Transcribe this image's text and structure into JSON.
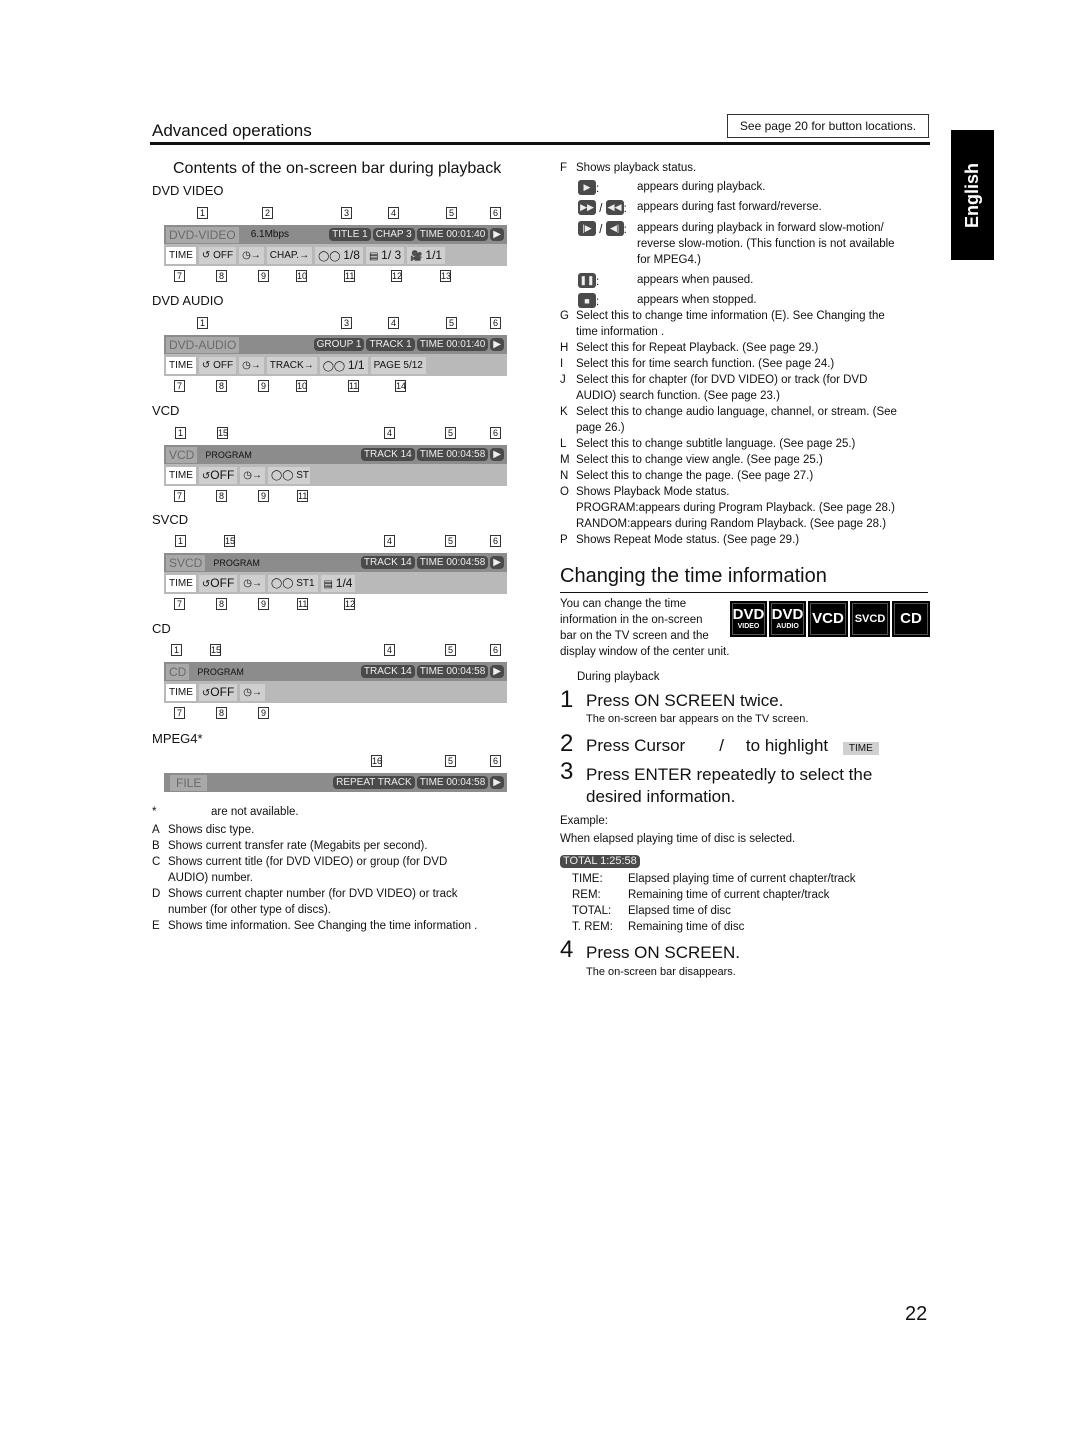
{
  "header": {
    "section_title": "Advanced operations",
    "button_note": "See page 20 for button locations.",
    "language_tab": "English"
  },
  "left": {
    "subtitle": "Contents of the on-screen bar during playback",
    "discs": [
      {
        "label": "DVD VIDEO",
        "type": "DVD-VIDEO",
        "rate": "6.1Mbps",
        "pills": [
          "TITLE  1",
          "CHAP  3",
          "TIME 00:01:40"
        ],
        "bottom": [
          "TIME",
          "OFF",
          "→",
          "CHAP.→",
          "1/8",
          "1/ 3",
          "1/1"
        ],
        "top_nums": [
          "1",
          "2",
          "3",
          "4",
          "5",
          "6"
        ],
        "bottom_nums": [
          "7",
          "8",
          "9",
          "10",
          "11",
          "12",
          "13"
        ]
      },
      {
        "label": "DVD AUDIO",
        "type": "DVD-AUDIO",
        "pills": [
          "GROUP 1",
          "TRACK 1",
          "TIME 00:01:40"
        ],
        "bottom": [
          "TIME",
          "OFF",
          "→",
          "TRACK→",
          "1/1",
          "PAGE 5/12"
        ],
        "top_nums": [
          "1",
          "3",
          "4",
          "5",
          "6"
        ],
        "bottom_nums": [
          "7",
          "8",
          "9",
          "10",
          "11",
          "14"
        ]
      },
      {
        "label": "VCD",
        "type": "VCD",
        "mode": "PROGRAM",
        "pills": [
          "TRACK 14",
          "TIME 00:04:58"
        ],
        "bottom": [
          "TIME",
          "OFF",
          "→",
          "ST"
        ],
        "top_nums": [
          "1",
          "15",
          "4",
          "5",
          "6"
        ],
        "bottom_nums": [
          "7",
          "8",
          "9",
          "11"
        ]
      },
      {
        "label": "SVCD",
        "type": "SVCD",
        "mode": "PROGRAM",
        "pills": [
          "TRACK 14",
          "TIME 00:04:58"
        ],
        "bottom": [
          "TIME",
          "OFF",
          "→",
          "ST1",
          "1/4"
        ],
        "top_nums": [
          "1",
          "15",
          "4",
          "5",
          "6"
        ],
        "bottom_nums": [
          "7",
          "8",
          "9",
          "11",
          "12"
        ]
      },
      {
        "label": "CD",
        "type": "CD",
        "mode": "PROGRAM",
        "pills": [
          "TRACK 14",
          "TIME 00:04:58"
        ],
        "bottom": [
          "TIME",
          "OFF",
          "→"
        ],
        "top_nums": [
          "1",
          "15",
          "4",
          "5",
          "6"
        ],
        "bottom_nums": [
          "7",
          "8",
          "9"
        ]
      },
      {
        "label": "MPEG4*",
        "type": "FILE",
        "pills": [
          "REPEAT TRACK",
          "TIME 00:04:58"
        ],
        "top_nums": [
          "16",
          "5",
          "6"
        ]
      }
    ],
    "footnote_mark": "*",
    "footnote": "are not available.",
    "items": [
      {
        "k": "A",
        "t": "Shows disc type."
      },
      {
        "k": "B",
        "t": "Shows current transfer rate (Megabits per second)."
      },
      {
        "k": "C",
        "t": "Shows current title (for DVD VIDEO) or group (for DVD",
        "t2": "AUDIO) number."
      },
      {
        "k": "D",
        "t": "Shows current chapter number (for DVD VIDEO) or track",
        "t2": "number (for other type of discs)."
      },
      {
        "k": "E",
        "t": "Shows time information. See   Changing the time information  ."
      }
    ]
  },
  "right": {
    "F": {
      "k": "F",
      "t": "Shows playback status."
    },
    "status": [
      {
        "sym": "▶",
        "t": "appears during playback."
      },
      {
        "sym": "▶▶",
        "sym2": "◀◀",
        "t": "appears during fast forward/reverse."
      },
      {
        "sym": "|▶",
        "sym2": "◀|",
        "t": "appears during playback in forward slow-motion/",
        "t2": "reverse slow-motion. (This function is not available",
        "t3": "for MPEG4.)"
      },
      {
        "sym": "❚❚",
        "t": "appears when paused."
      },
      {
        "sym": "■",
        "t": "appears when stopped."
      }
    ],
    "items": [
      {
        "k": "G",
        "t": "Select this to change time information (E). See   Changing the",
        "t2": "time information  ."
      },
      {
        "k": "H",
        "t": "Select this for Repeat Playback. (See page 29.)"
      },
      {
        "k": "I",
        "t": "Select this for time search function. (See page 24.)"
      },
      {
        "k": "J",
        "t": "Select this for chapter (for DVD VIDEO) or track (for DVD",
        "t2": "AUDIO) search function. (See page 23.)"
      },
      {
        "k": "K",
        "t": "Select this to change audio language, channel, or stream. (See",
        "t2": "page 26.)"
      },
      {
        "k": "L",
        "t": "Select this to change subtitle language. (See page 25.)"
      },
      {
        "k": "M",
        "t": "Select this to change view angle. (See page 25.)"
      },
      {
        "k": "N",
        "t": "Select this to change the page. (See page 27.)"
      },
      {
        "k": "O",
        "t": "Shows Playback Mode status.",
        "t2": "PROGRAM:appears during Program Playback. (See page 28.)",
        "t3": "RANDOM:appears during Random Playback. (See page 28.)"
      },
      {
        "k": "P",
        "t": "Shows Repeat Mode status. (See page 29.)"
      }
    ],
    "section2": {
      "title": "Changing the time information",
      "intro": [
        "You can change the time",
        "information in the on-screen",
        "bar on the TV screen and the",
        "display window of the center unit."
      ],
      "badges": [
        {
          "main": "DVD",
          "sub": "VIDEO"
        },
        {
          "main": "DVD",
          "sub": "AUDIO"
        },
        {
          "main": "VCD"
        },
        {
          "main": "SVCD"
        },
        {
          "main": "CD"
        }
      ],
      "during": "During playback",
      "steps": [
        {
          "n": "1",
          "t": "Press ON SCREEN twice.",
          "sub": "The on-screen bar appears on the TV screen."
        },
        {
          "n": "2",
          "t": "Press Cursor",
          "mid": "/",
          "t_end": "to highlight",
          "chip": "TIME"
        },
        {
          "n": "3",
          "t": "Press ENTER repeatedly to select the",
          "t2": "desired information."
        },
        {
          "n": "4",
          "t": "Press ON SCREEN.",
          "sub": "The on-screen bar disappears."
        }
      ],
      "example_label": "Example:",
      "example_text": "When elapsed playing time of disc is selected.",
      "total_display": "TOTAL  1:25:58",
      "defs": [
        {
          "k": "TIME:",
          "t": "Elapsed playing time of current chapter/track"
        },
        {
          "k": "REM:",
          "t": "Remaining time of current chapter/track"
        },
        {
          "k": "TOTAL:",
          "t": "Elapsed time of disc"
        },
        {
          "k": "T. REM:",
          "t": "Remaining time of disc"
        }
      ]
    }
  },
  "page_number": "22"
}
